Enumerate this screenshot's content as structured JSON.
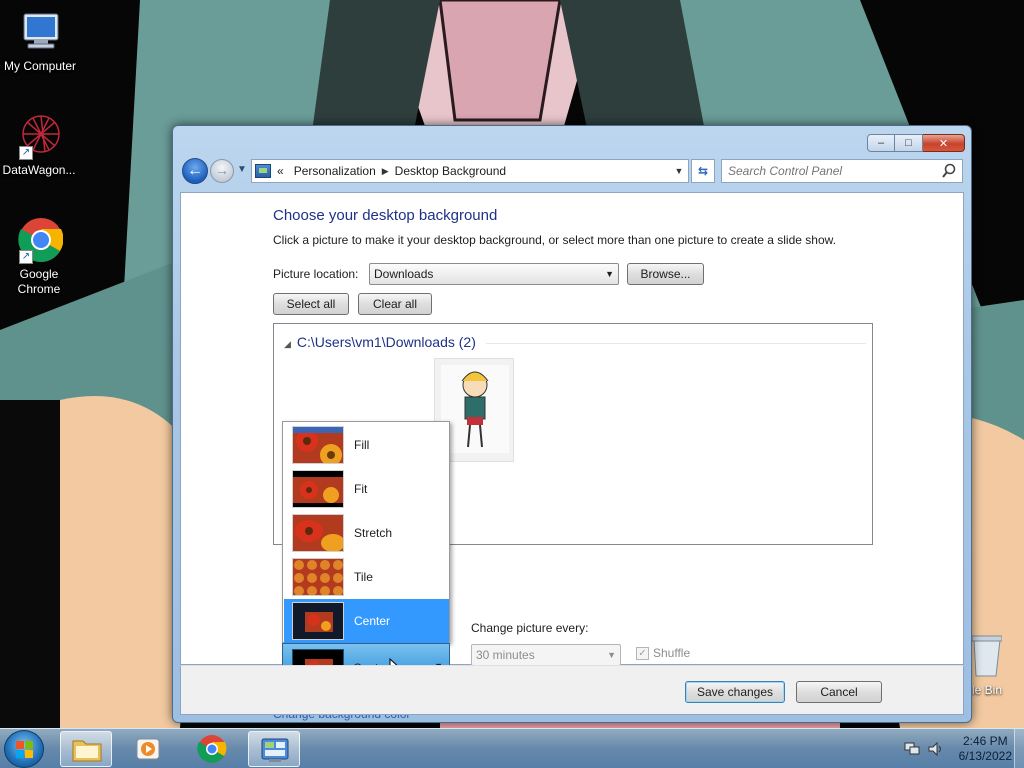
{
  "desktop": {
    "icons": [
      {
        "label": "My Computer"
      },
      {
        "label": "DataWagon..."
      },
      {
        "label": "Google\nChrome"
      }
    ],
    "recycle_label": "cle Bin"
  },
  "window": {
    "controls": {
      "minimize": "–",
      "maximize": "□",
      "close": "✕"
    },
    "address": {
      "crumbs": [
        "Personalization",
        "Desktop Background"
      ],
      "prefix": "«"
    },
    "search": {
      "placeholder": "Search Control Panel"
    },
    "heading": "Choose your desktop background",
    "subtext": "Click a picture to make it your desktop background, or select more than one picture to create a slide show.",
    "picture_location_label": "Picture location:",
    "picture_location_value": "Downloads",
    "browse_label": "Browse...",
    "select_all_label": "Select all",
    "clear_all_label": "Clear all",
    "group_header": "C:\\Users\\vm1\\Downloads (2)",
    "position_menu": {
      "items": [
        "Fill",
        "Fit",
        "Stretch",
        "Tile",
        "Center"
      ],
      "selected": "Center"
    },
    "position_value": "Center",
    "change_picture_label": "Change picture every:",
    "interval_value": "30 minutes",
    "shuffle_label": "Shuffle",
    "change_color_link": "Change background color",
    "save_label": "Save changes",
    "cancel_label": "Cancel"
  },
  "taskbar": {
    "time": "2:46 PM",
    "date": "6/13/2022"
  },
  "colors": {
    "heading": "#1e3287",
    "selection": "#3399ff",
    "link": "#2a5ea8"
  }
}
